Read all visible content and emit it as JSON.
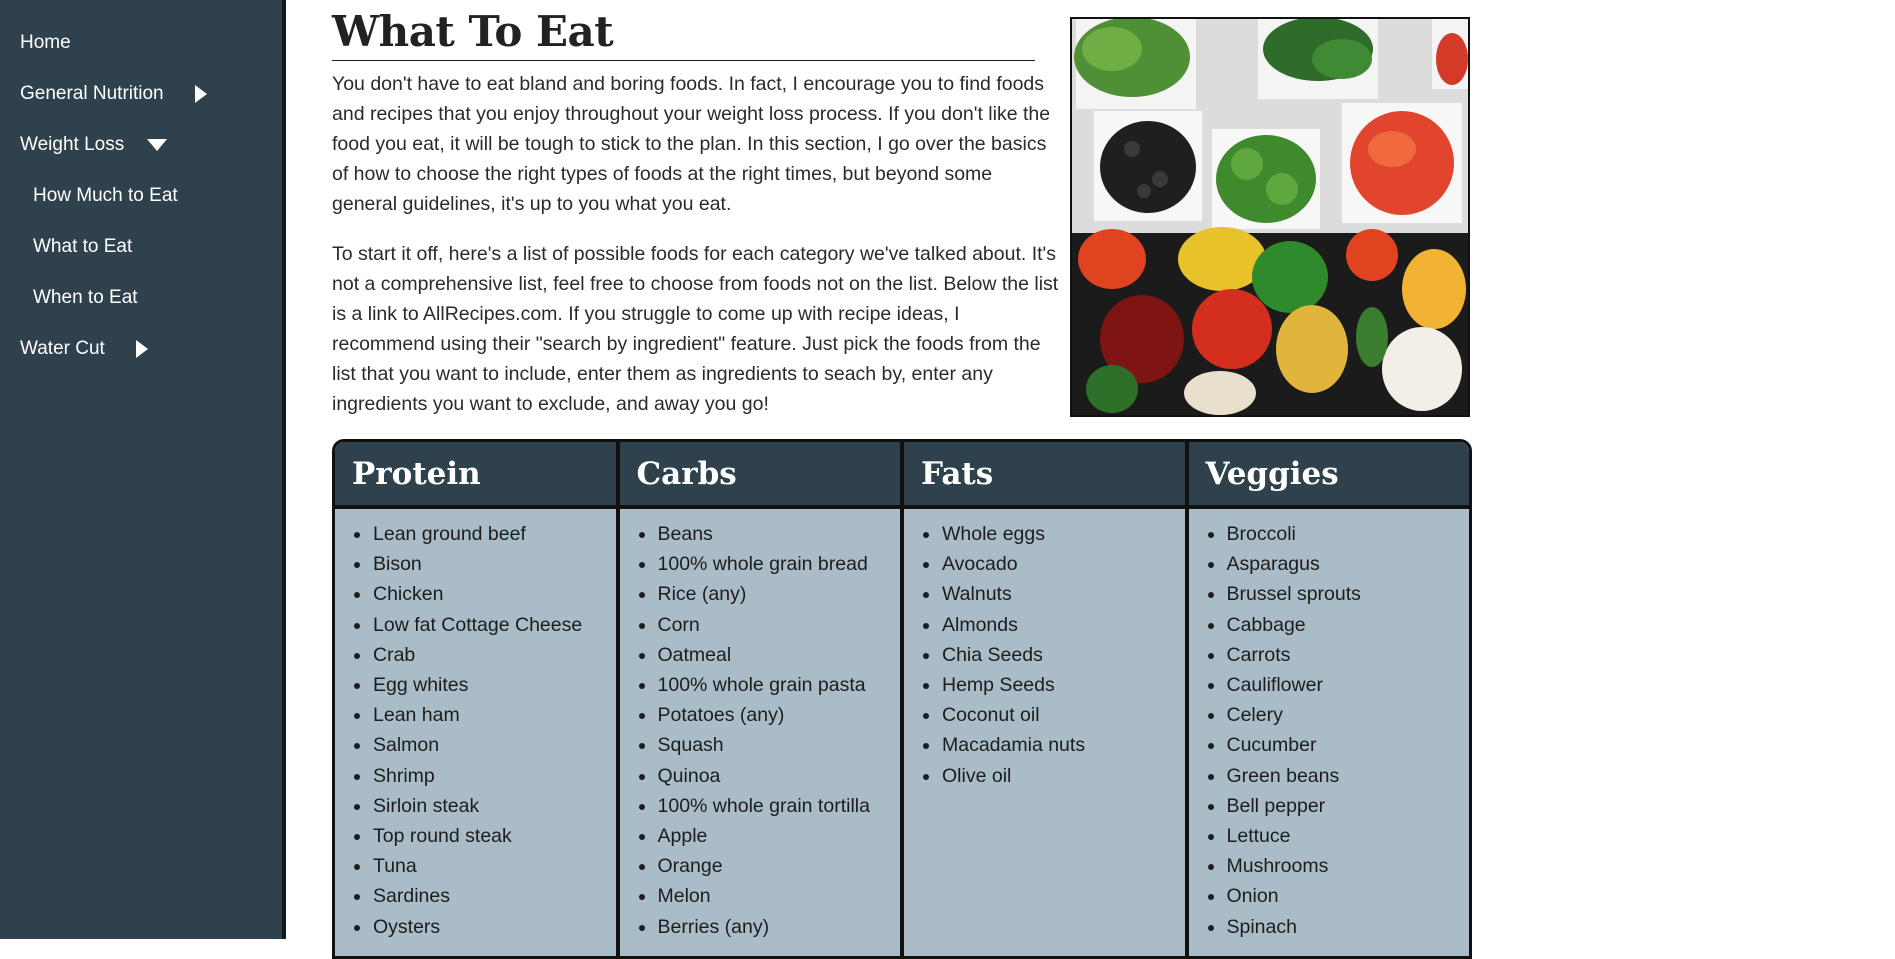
{
  "sidebar": {
    "items": [
      {
        "label": "Home"
      },
      {
        "label": "General Nutrition",
        "expanded": false
      },
      {
        "label": "Weight Loss",
        "expanded": true
      },
      {
        "label": "How Much to Eat"
      },
      {
        "label": "What to Eat"
      },
      {
        "label": "When to Eat"
      },
      {
        "label": "Water Cut",
        "expanded": false
      }
    ]
  },
  "page": {
    "title": "What To Eat",
    "paragraph1": "You don't have to eat bland and boring foods. In fact, I encourage you to find foods and recipes that you enjoy throughout your weight loss process. If you don't like the food you eat, it will be tough to stick to the plan. In this section, I go over the basics of how to choose the right types of foods at the right times, but beyond some general guidelines, it's up to you what you eat.",
    "paragraph2": "To start it off, here's a list of possible foods for each category we've talked about. It's not a comprehensive list, feel free to choose from foods not on the list. Below the list is a link to AllRecipes.com. If you struggle to come up with recipe ideas, I recommend using their \"search by ingredient\" feature. Just pick the foods from the list that you want to include, enter them as ingredients to seach by, enter any ingredients you want to exclude, and away you go!"
  },
  "food_table": {
    "columns": [
      {
        "header": "Protein",
        "items": [
          "Lean ground beef",
          "Bison",
          "Chicken",
          "Low fat Cottage Cheese",
          "Crab",
          "Egg whites",
          "Lean ham",
          "Salmon",
          "Shrimp",
          "Sirloin steak",
          "Top round steak",
          "Tuna",
          "Sardines",
          "Oysters"
        ]
      },
      {
        "header": "Carbs",
        "items": [
          "Beans",
          "100% whole grain bread",
          "Rice (any)",
          "Corn",
          "Oatmeal",
          "100% whole grain pasta",
          "Potatoes (any)",
          "Squash",
          "Quinoa",
          "100% whole grain tortilla",
          "Apple",
          "Orange",
          "Melon",
          "Berries (any)"
        ]
      },
      {
        "header": "Fats",
        "items": [
          "Whole eggs",
          "Avocado",
          "Walnuts",
          "Almonds",
          "Chia Seeds",
          "Hemp Seeds",
          "Coconut oil",
          "Macadamia nuts",
          "Olive oil"
        ]
      },
      {
        "header": "Veggies",
        "items": [
          "Broccoli",
          "Asparagus",
          "Brussel sprouts",
          "Cabbage",
          "Carrots",
          "Cauliflower",
          "Celery",
          "Cucumber",
          "Green beans",
          "Bell pepper",
          "Lettuce",
          "Mushrooms",
          "Onion",
          "Spinach"
        ]
      }
    ]
  },
  "colors": {
    "sidebar_bg": "#2f414d",
    "table_header_bg": "#2f414d",
    "table_body_bg": "#a9bcc7",
    "border": "#111111"
  }
}
